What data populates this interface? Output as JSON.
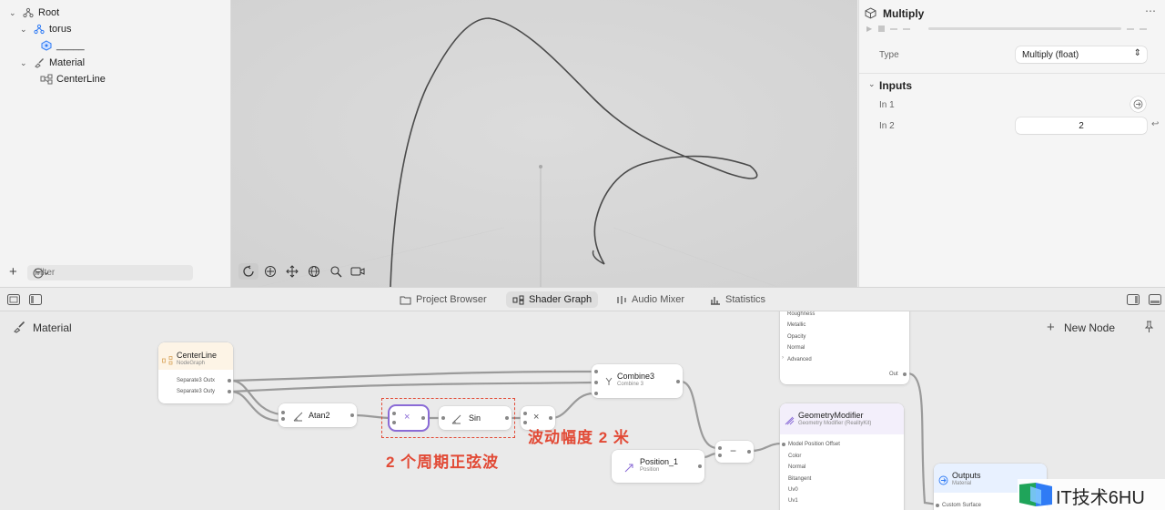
{
  "tree": {
    "items": [
      {
        "label": "Root"
      },
      {
        "label": "torus"
      },
      {
        "label": "_____"
      },
      {
        "label": "Material"
      },
      {
        "label": "CenterLine"
      }
    ],
    "filter_placeholder": "Filter"
  },
  "inspector": {
    "title": "Multiply",
    "type_label": "Type",
    "type_value": "Multiply (float)",
    "inputs_section": "Inputs",
    "in1_label": "In 1",
    "in2_label": "In 2",
    "in2_value": "2"
  },
  "tabs": [
    {
      "label": "Project Browser"
    },
    {
      "label": "Shader Graph"
    },
    {
      "label": "Audio Mixer"
    },
    {
      "label": "Statistics"
    }
  ],
  "graph": {
    "context_title": "Material",
    "new_node_label": "New Node",
    "nodes": {
      "centerline": {
        "title": "CenterLine",
        "subtitle": "NodeGraph",
        "ports": [
          "Separate3 Outx",
          "Separate3 Outy"
        ]
      },
      "atan2": {
        "title": "Atan2"
      },
      "multiply_selected": {
        "symbol": "×"
      },
      "sin": {
        "title": "Sin"
      },
      "multiply2": {
        "symbol": "×"
      },
      "combine3": {
        "title": "Combine3",
        "subtitle": "Combine 3"
      },
      "position": {
        "title": "Position_1",
        "subtitle": "Position"
      },
      "subtract": {
        "symbol": "−"
      },
      "surface": {
        "ports": [
          "Roughness",
          "Metallic",
          "Opacity",
          "Normal",
          "Advanced"
        ],
        "out": "Out"
      },
      "geometry": {
        "title": "GeometryModifier",
        "subtitle": "Geometry Modifier (RealityKit)",
        "ports": [
          "Model Position Offset",
          "Color",
          "Normal",
          "Bitangent",
          "Uv0",
          "Uv1"
        ]
      },
      "outputs": {
        "title": "Outputs",
        "subtitle": "Material",
        "ports": [
          "Custom Surface"
        ]
      }
    },
    "annotations": {
      "amplitude": "波动幅度 2 米",
      "periods": "2 个周期正弦波"
    }
  },
  "watermark": {
    "text": "IT技术6HU"
  },
  "colors": {
    "accent_purple": "#8a6bd6",
    "annotation_red": "#e24a36",
    "icon_blue": "#2f7bf5"
  }
}
